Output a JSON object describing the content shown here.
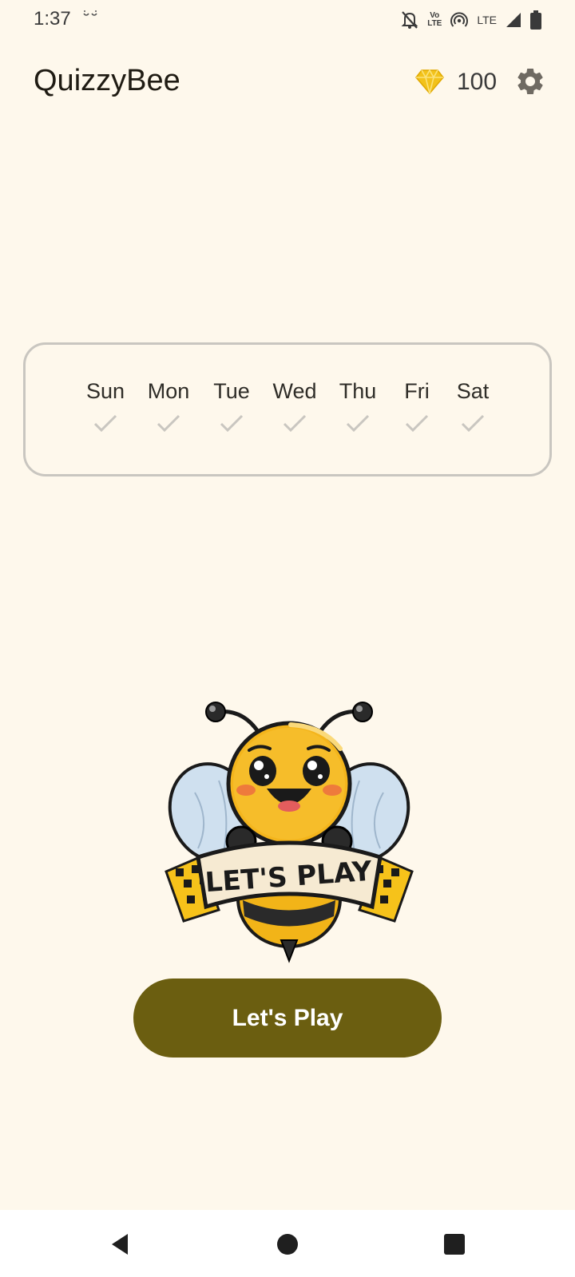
{
  "status_bar": {
    "time": "1:37",
    "volte_line1": "Vo",
    "volte_line2": "LTE",
    "network": "LTE"
  },
  "app": {
    "title": "QuizzyBee",
    "gem_count": "100",
    "gem_color": "#f2c21a"
  },
  "week": {
    "days": [
      {
        "label": "Sun",
        "checked": true
      },
      {
        "label": "Mon",
        "checked": true
      },
      {
        "label": "Tue",
        "checked": true
      },
      {
        "label": "Wed",
        "checked": true
      },
      {
        "label": "Thu",
        "checked": true
      },
      {
        "label": "Fri",
        "checked": true
      },
      {
        "label": "Sat",
        "checked": true
      }
    ],
    "check_color": "#c9c6c0"
  },
  "mascot": {
    "banner_text": "LET'S PLAY"
  },
  "cta": {
    "label": "Let's Play",
    "color": "#6b5e10"
  },
  "nav": {
    "icons": [
      "back-icon",
      "home-icon",
      "recents-icon"
    ]
  }
}
